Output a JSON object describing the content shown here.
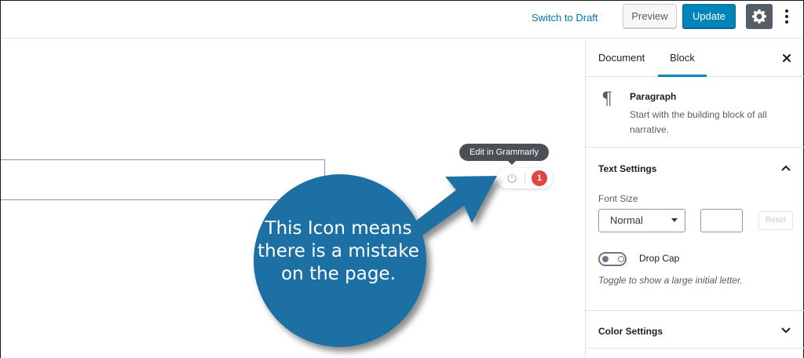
{
  "header": {
    "switch_to_draft": "Switch to Draft",
    "preview_label": "Preview",
    "update_label": "Update",
    "settings_icon": "gear-icon",
    "more_icon": "more-vertical-icon",
    "accent_color": "#0085ba"
  },
  "grammarly": {
    "tooltip": "Edit in Grammarly",
    "power_icon": "power-icon",
    "issue_count": "1",
    "badge_color": "#e1453f"
  },
  "annotation": {
    "text": "This Icon  means there is a mistake on the page.",
    "bubble_color": "#1f6fa3"
  },
  "sidebar": {
    "tabs": [
      {
        "label": "Document",
        "active": false
      },
      {
        "label": "Block",
        "active": true
      }
    ],
    "close_icon": "close-icon",
    "block": {
      "icon": "paragraph-icon",
      "glyph": "¶",
      "title": "Paragraph",
      "description": "Start with the building block of all narrative."
    },
    "text_settings": {
      "title": "Text Settings",
      "expanded": true,
      "font_size_label": "Font Size",
      "font_size_value": "Normal",
      "custom_value": "",
      "reset_label": "Reset",
      "drop_cap_label": "Drop Cap",
      "drop_cap_enabled": false,
      "drop_cap_help": "Toggle to show a large initial letter."
    },
    "color_settings": {
      "title": "Color Settings",
      "expanded": false
    }
  }
}
